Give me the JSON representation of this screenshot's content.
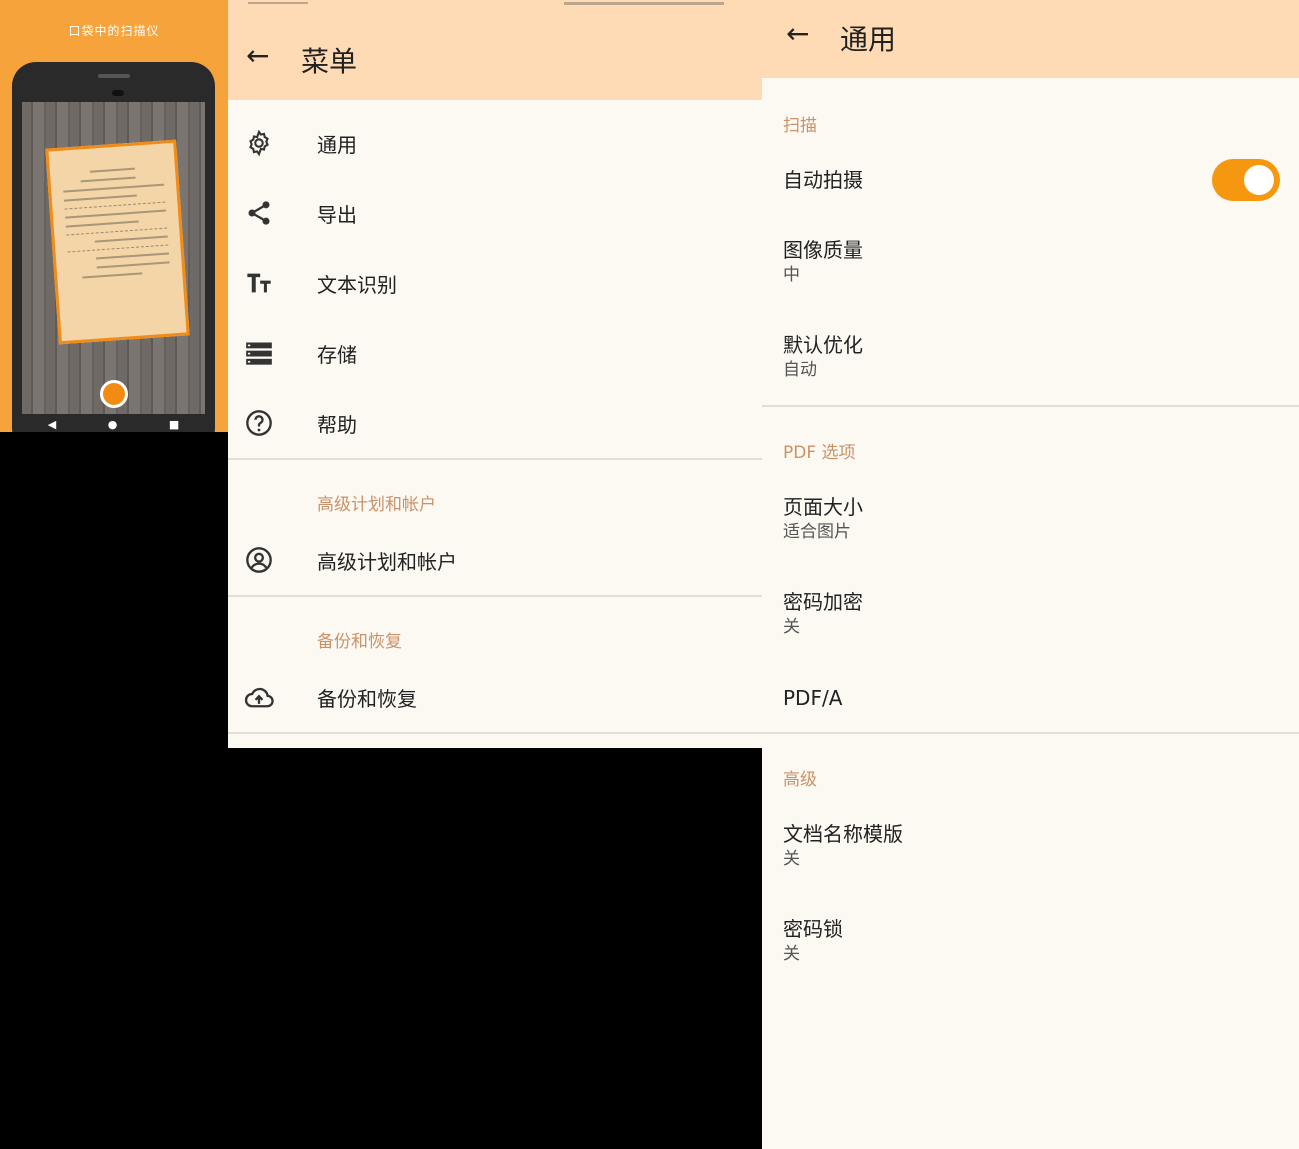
{
  "promo": {
    "caption": "口袋中的扫描仪",
    "nav": {
      "back": "◀",
      "home": "●",
      "recents": "■"
    }
  },
  "menu": {
    "title": "菜单",
    "items": [
      {
        "label": "通用",
        "icon": "gear-icon"
      },
      {
        "label": "导出",
        "icon": "share-icon"
      },
      {
        "label": "文本识别",
        "icon": "text-size-icon"
      },
      {
        "label": "存储",
        "icon": "storage-icon"
      },
      {
        "label": "帮助",
        "icon": "help-icon"
      }
    ],
    "premium_header": "高级计划和帐户",
    "premium_item": {
      "label": "高级计划和帐户",
      "icon": "account-icon"
    },
    "backup_header": "备份和恢复",
    "backup_item": {
      "label": "备份和恢复",
      "icon": "cloud-upload-icon"
    }
  },
  "settings": {
    "title": "通用",
    "scan_header": "扫描",
    "auto_capture": {
      "title": "自动拍摄",
      "enabled": true
    },
    "image_quality": {
      "title": "图像质量",
      "value": "中"
    },
    "default_opt": {
      "title": "默认优化",
      "value": "自动"
    },
    "pdf_header": "PDF 选项",
    "page_size": {
      "title": "页面大小",
      "value": "适合图片"
    },
    "password_enc": {
      "title": "密码加密",
      "value": "关"
    },
    "pdfa": {
      "title": "PDF/A"
    },
    "advanced_header": "高级",
    "doc_name": {
      "title": "文档名称模版",
      "value": "关"
    },
    "pass_lock": {
      "title": "密码锁",
      "value": "关"
    }
  },
  "colors": {
    "accent": "#f5980f",
    "appbar": "#fedbb5",
    "background": "#fcf8f2",
    "section_header": "#c9936a",
    "promo_bg": "#f5a33a"
  }
}
